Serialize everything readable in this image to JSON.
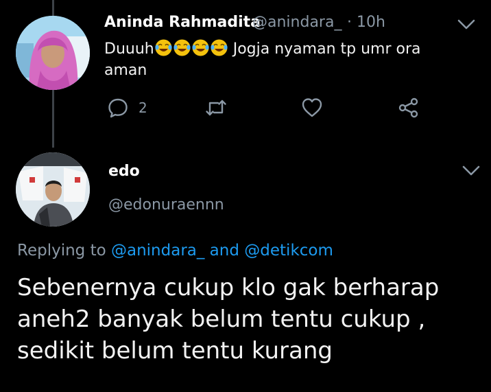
{
  "tweet1": {
    "name": "Aninda Rahmadita",
    "handle": "@anindara_",
    "time": "· 10h",
    "text_start": "Duuuh",
    "emoji_count": 4,
    "emoji_name": "face-with-tears-of-joy",
    "text_end": " Jogja nyaman tp umr ora",
    "text_line2": "aman",
    "reply_count": "2"
  },
  "tweet2": {
    "name": "edo",
    "handle": "@edonuraennn",
    "replying_prefix": "Replying to ",
    "mention1": "@anindara_",
    "replying_join": " and ",
    "mention2": "@detikcom",
    "body_line1": "Sebenernya cukup klo gak berharap",
    "body_line2": "aneh2 banyak belum tentu cukup ,",
    "body_line3": "sedikit belum tentu kurang"
  },
  "colors": {
    "background": "#000000",
    "secondary_text": "#8b98a5",
    "link": "#1d9bf0",
    "thread_line": "#3d4248"
  }
}
